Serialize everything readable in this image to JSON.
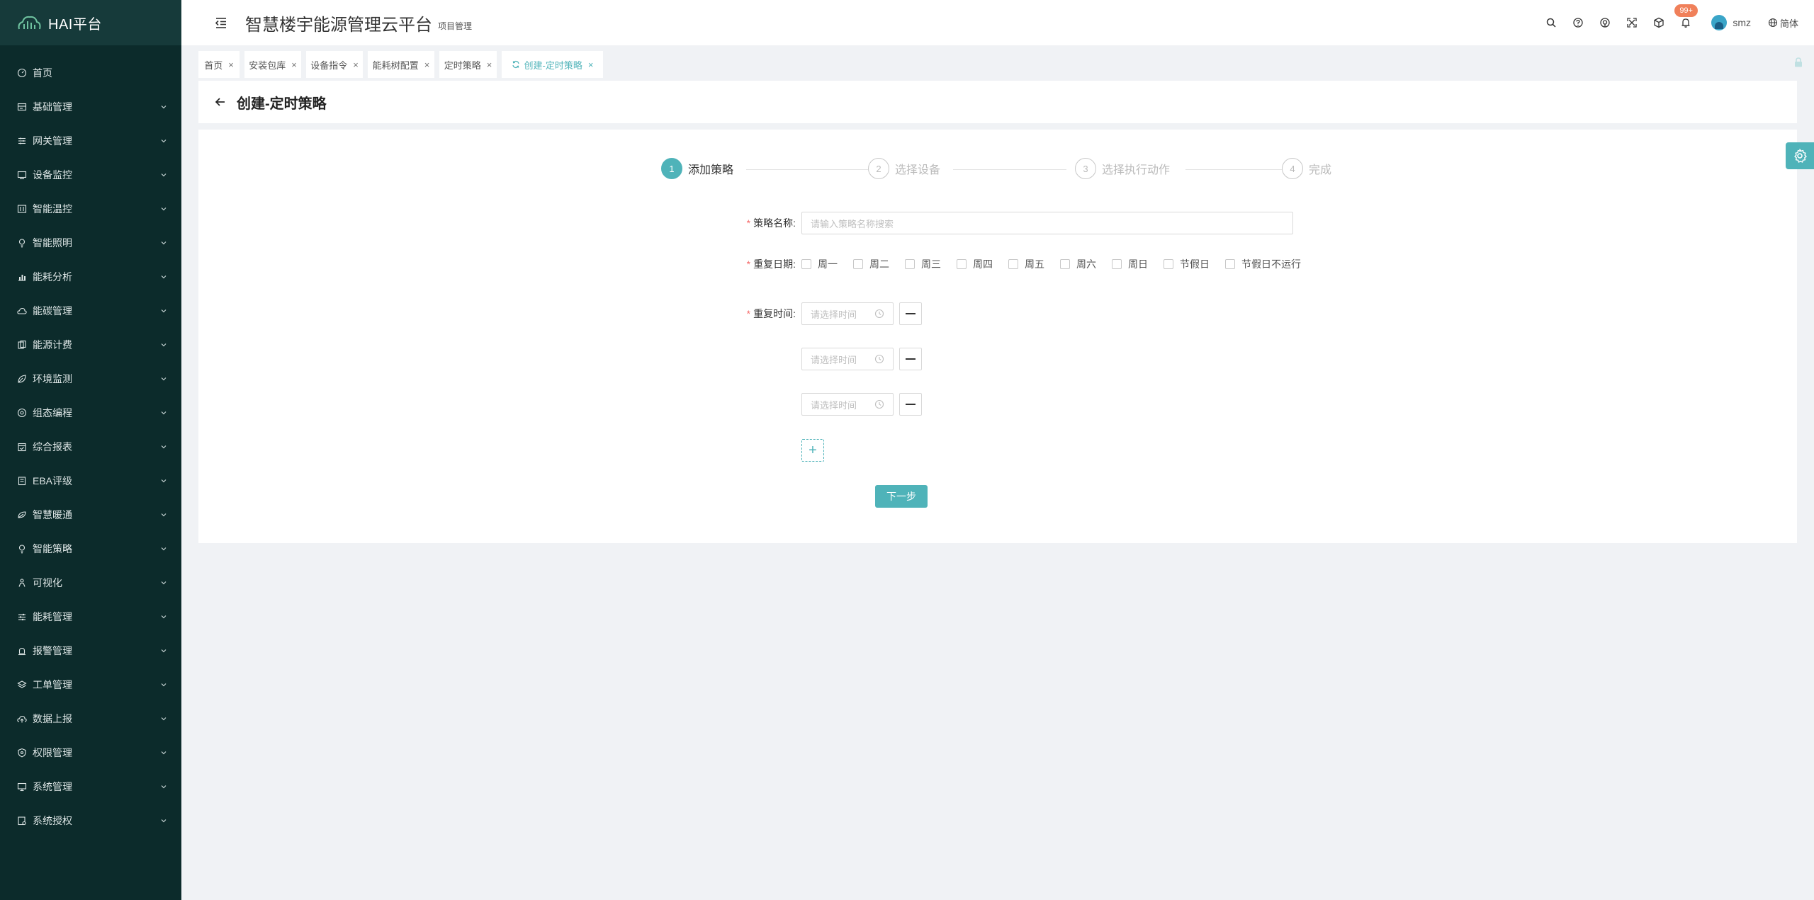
{
  "app": {
    "logo_text": "HAI平台",
    "title": "智慧楼宇能源管理云平台",
    "subtitle": "项目管理"
  },
  "sidebar": {
    "items": [
      {
        "label": "首页",
        "icon": "dashboard-icon",
        "expandable": false
      },
      {
        "label": "基础管理",
        "icon": "database-icon",
        "expandable": true
      },
      {
        "label": "网关管理",
        "icon": "gateway-icon",
        "expandable": true
      },
      {
        "label": "设备监控",
        "icon": "monitor-icon",
        "expandable": true
      },
      {
        "label": "智能温控",
        "icon": "thermostat-icon",
        "expandable": true
      },
      {
        "label": "智能照明",
        "icon": "bulb-icon",
        "expandable": true
      },
      {
        "label": "能耗分析",
        "icon": "bar-chart-icon",
        "expandable": true
      },
      {
        "label": "能碳管理",
        "icon": "cloud-icon",
        "expandable": true
      },
      {
        "label": "能源计费",
        "icon": "billing-icon",
        "expandable": true
      },
      {
        "label": "环境监测",
        "icon": "leaf-icon",
        "expandable": true
      },
      {
        "label": "组态编程",
        "icon": "target-icon",
        "expandable": true
      },
      {
        "label": "综合报表",
        "icon": "report-icon",
        "expandable": true
      },
      {
        "label": "EBA评级",
        "icon": "rating-icon",
        "expandable": true
      },
      {
        "label": "智慧暖通",
        "icon": "hvac-icon",
        "expandable": true
      },
      {
        "label": "智能策略",
        "icon": "bulb-icon",
        "expandable": true
      },
      {
        "label": "可视化",
        "icon": "visual-icon",
        "expandable": true
      },
      {
        "label": "能耗管理",
        "icon": "sliders-icon",
        "expandable": true
      },
      {
        "label": "报警管理",
        "icon": "alarm-icon",
        "expandable": true
      },
      {
        "label": "工单管理",
        "icon": "layers-icon",
        "expandable": true
      },
      {
        "label": "数据上报",
        "icon": "cloud-upload-icon",
        "expandable": true
      },
      {
        "label": "权限管理",
        "icon": "shield-icon",
        "expandable": true
      },
      {
        "label": "系统管理",
        "icon": "desktop-icon",
        "expandable": true
      },
      {
        "label": "系统授权",
        "icon": "authorize-icon",
        "expandable": true
      }
    ]
  },
  "header": {
    "notification_badge": "99+",
    "username": "smz",
    "language": "简体"
  },
  "tabs": [
    {
      "label": "首页",
      "active": false
    },
    {
      "label": "安装包库",
      "active": false
    },
    {
      "label": "设备指令",
      "active": false
    },
    {
      "label": "能耗树配置",
      "active": false
    },
    {
      "label": "定时策略",
      "active": false
    },
    {
      "label": "创建-定时策略",
      "active": true
    }
  ],
  "page": {
    "title": "创建-定时策略"
  },
  "steps": [
    {
      "num": "1",
      "label": "添加策略",
      "active": true
    },
    {
      "num": "2",
      "label": "选择设备",
      "active": false
    },
    {
      "num": "3",
      "label": "选择执行动作",
      "active": false
    },
    {
      "num": "4",
      "label": "完成",
      "active": false
    }
  ],
  "form": {
    "name_label": "策略名称:",
    "name_placeholder": "请输入策略名称搜索",
    "date_label": "重复日期:",
    "days": [
      "周一",
      "周二",
      "周三",
      "周四",
      "周五",
      "周六",
      "周日",
      "节假日",
      "节假日不运行"
    ],
    "time_label": "重复时间:",
    "time_placeholder": "请选择时间",
    "time_slots": 3,
    "next_button": "下一步"
  },
  "colors": {
    "accent": "#4fb3b9",
    "sidebar_bg": "#0c2b2b",
    "required": "#f56c6c"
  }
}
